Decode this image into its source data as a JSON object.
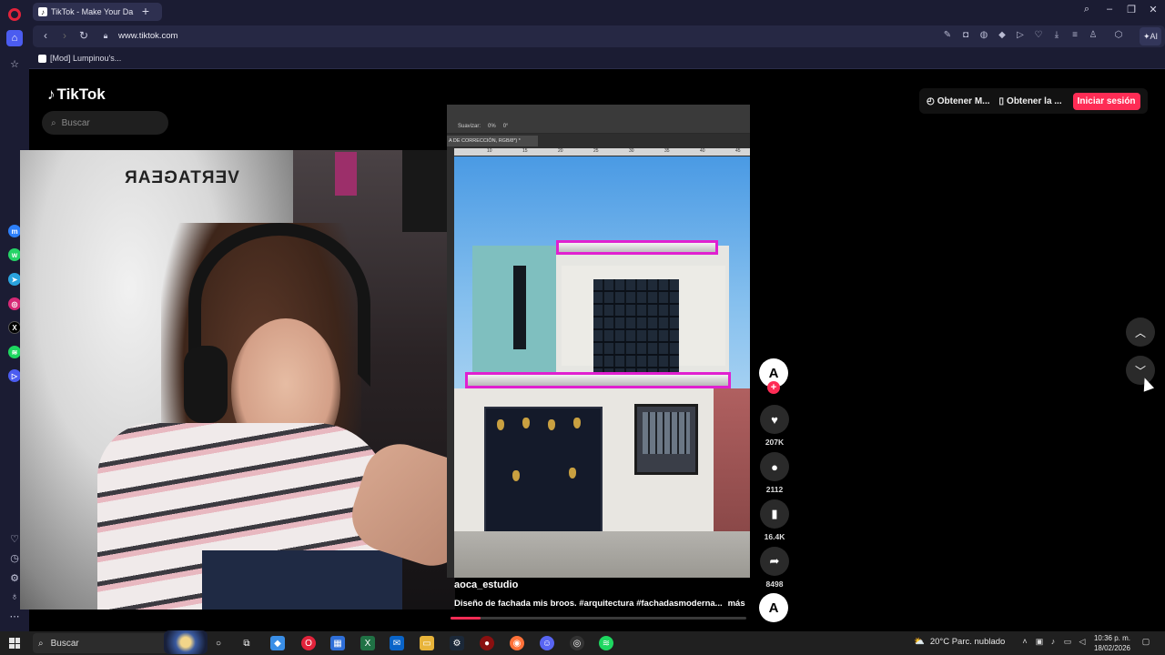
{
  "browser": {
    "tab_title": "TikTok - Make Your Da",
    "tab_favicon": "tiktok-icon",
    "url": "www.tiktok.com",
    "bookmark": "[Mod] Lumpinou's...",
    "ai_label": "AI"
  },
  "tiktok": {
    "logo": "TikTok",
    "search_placeholder": "Buscar",
    "header": {
      "get_coins": "Obtener M...",
      "get_app": "Obtener la ...",
      "login": "Iniciar sesión"
    },
    "video": {
      "username": "aoca_estudio",
      "description": "Diseño de fachada mis broos. #arquitectura #fachadasmoderna...",
      "more": "más",
      "progress_fraction": 0.1,
      "ps_options": [
        "Suavizar:",
        "0%",
        "0°"
      ],
      "ps_tab": "A DE CORRECCIÓN, RGB/8*) *",
      "ps_ruler": [
        "10",
        "15",
        "20",
        "25",
        "30",
        "35",
        "40",
        "45"
      ]
    },
    "actions": {
      "likes": "207K",
      "comments": "2112",
      "saves": "16.4K",
      "shares": "8498"
    }
  },
  "webcam": {
    "chair_brand": "VERTAGEAR"
  },
  "taskbar": {
    "search": "Buscar",
    "weather": "20°C  Parc. nublado",
    "time": "10:36 p. m.",
    "date": "18/02/2026"
  },
  "colors": {
    "tiktok_red": "#fe2c55",
    "opera_red": "#e2233b",
    "browser_bg": "#1b1c33",
    "highlight_magenta": "#e020d0"
  }
}
